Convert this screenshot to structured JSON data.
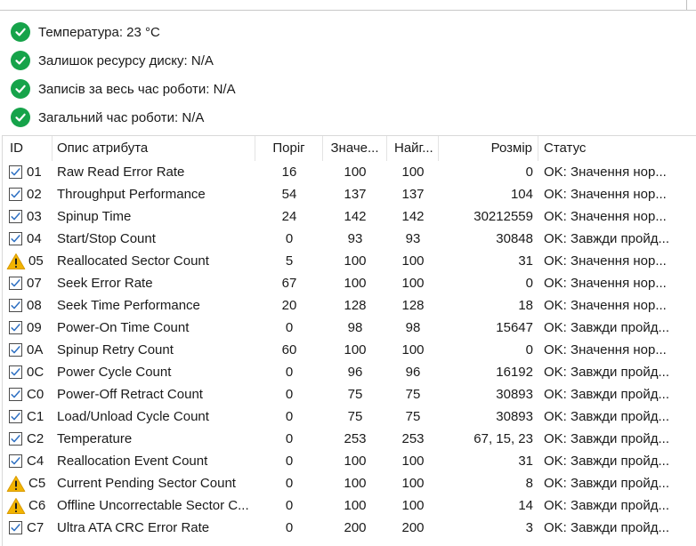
{
  "summary": [
    {
      "label": "Температура: 23 °C",
      "status": "ok"
    },
    {
      "label": "Залишок ресурсу диску: N/A",
      "status": "ok"
    },
    {
      "label": "Записів за весь час роботи: N/A",
      "status": "ok"
    },
    {
      "label": "Загальний час роботи: N/A",
      "status": "ok"
    }
  ],
  "table": {
    "columns": [
      "ID",
      "Опис атрибута",
      "Поріг",
      "Значе...",
      "Найг...",
      "Розмір",
      "Статус"
    ],
    "rows": [
      {
        "icon": "checkbox",
        "id": "01",
        "name": "Raw Read Error Rate",
        "threshold": "16",
        "value": "100",
        "worst": "100",
        "raw": "0",
        "status": "OK: Значення нор..."
      },
      {
        "icon": "checkbox",
        "id": "02",
        "name": "Throughput Performance",
        "threshold": "54",
        "value": "137",
        "worst": "137",
        "raw": "104",
        "status": "OK: Значення нор..."
      },
      {
        "icon": "checkbox",
        "id": "03",
        "name": "Spinup Time",
        "threshold": "24",
        "value": "142",
        "worst": "142",
        "raw": "30212559",
        "status": "OK: Значення нор..."
      },
      {
        "icon": "checkbox",
        "id": "04",
        "name": "Start/Stop Count",
        "threshold": "0",
        "value": "93",
        "worst": "93",
        "raw": "30848",
        "status": "OK: Завжди пройд..."
      },
      {
        "icon": "warning",
        "id": "05",
        "name": "Reallocated Sector Count",
        "threshold": "5",
        "value": "100",
        "worst": "100",
        "raw": "31",
        "status": "OK: Значення нор..."
      },
      {
        "icon": "checkbox",
        "id": "07",
        "name": "Seek Error Rate",
        "threshold": "67",
        "value": "100",
        "worst": "100",
        "raw": "0",
        "status": "OK: Значення нор..."
      },
      {
        "icon": "checkbox",
        "id": "08",
        "name": "Seek Time Performance",
        "threshold": "20",
        "value": "128",
        "worst": "128",
        "raw": "18",
        "status": "OK: Значення нор..."
      },
      {
        "icon": "checkbox",
        "id": "09",
        "name": "Power-On Time Count",
        "threshold": "0",
        "value": "98",
        "worst": "98",
        "raw": "15647",
        "status": "OK: Завжди пройд..."
      },
      {
        "icon": "checkbox",
        "id": "0A",
        "name": "Spinup Retry Count",
        "threshold": "60",
        "value": "100",
        "worst": "100",
        "raw": "0",
        "status": "OK: Значення нор..."
      },
      {
        "icon": "checkbox",
        "id": "0C",
        "name": "Power Cycle Count",
        "threshold": "0",
        "value": "96",
        "worst": "96",
        "raw": "16192",
        "status": "OK: Завжди пройд..."
      },
      {
        "icon": "checkbox",
        "id": "C0",
        "name": "Power-Off Retract Count",
        "threshold": "0",
        "value": "75",
        "worst": "75",
        "raw": "30893",
        "status": "OK: Завжди пройд..."
      },
      {
        "icon": "checkbox",
        "id": "C1",
        "name": "Load/Unload Cycle Count",
        "threshold": "0",
        "value": "75",
        "worst": "75",
        "raw": "30893",
        "status": "OK: Завжди пройд..."
      },
      {
        "icon": "checkbox",
        "id": "C2",
        "name": "Temperature",
        "threshold": "0",
        "value": "253",
        "worst": "253",
        "raw": "67, 15, 23",
        "status": "OK: Завжди пройд..."
      },
      {
        "icon": "checkbox",
        "id": "C4",
        "name": "Reallocation Event Count",
        "threshold": "0",
        "value": "100",
        "worst": "100",
        "raw": "31",
        "status": "OK: Завжди пройд..."
      },
      {
        "icon": "warning",
        "id": "C5",
        "name": "Current Pending Sector Count",
        "threshold": "0",
        "value": "100",
        "worst": "100",
        "raw": "8",
        "status": "OK: Завжди пройд..."
      },
      {
        "icon": "warning",
        "id": "C6",
        "name": "Offline Uncorrectable Sector C...",
        "threshold": "0",
        "value": "100",
        "worst": "100",
        "raw": "14",
        "status": "OK: Завжди пройд..."
      },
      {
        "icon": "checkbox",
        "id": "C7",
        "name": "Ultra ATA CRC Error Rate",
        "threshold": "0",
        "value": "200",
        "worst": "200",
        "raw": "3",
        "status": "OK: Завжди пройд..."
      }
    ]
  },
  "colors": {
    "ok": "#16a34a",
    "warning": "#f2b400"
  }
}
